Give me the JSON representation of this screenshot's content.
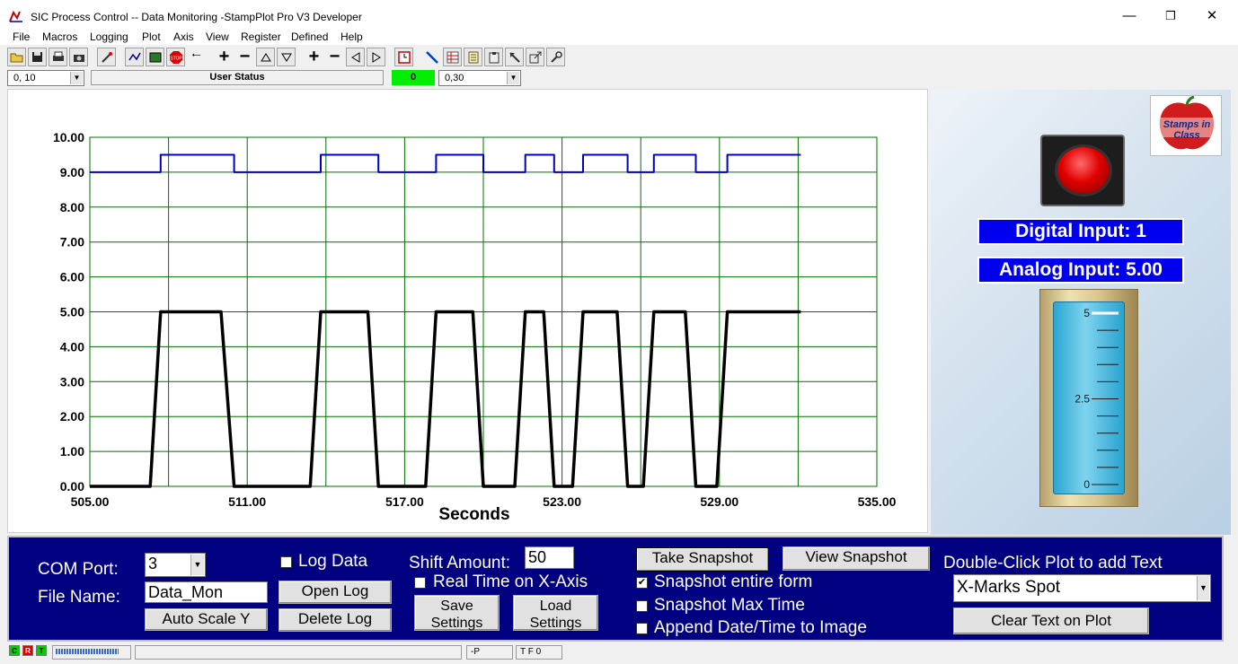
{
  "window": {
    "title": "SIC Process Control -- Data Monitoring  -StampPlot Pro V3 Developer",
    "minimize": "—",
    "maximize": "❐",
    "close": "✕"
  },
  "menu": [
    "File",
    "Macros",
    "Logging",
    "Plot",
    "Axis",
    "View",
    "Register",
    "Defined",
    "Help"
  ],
  "statusrow": {
    "left_combo": "0, 10",
    "user_status": "User Status",
    "green_value": "0",
    "right_combo": "0,30"
  },
  "chart_data": {
    "type": "line",
    "xlabel": "Seconds",
    "xlim": [
      505,
      535
    ],
    "ylim": [
      0,
      10
    ],
    "xticks": [
      "505.00",
      "511.00",
      "517.00",
      "523.00",
      "529.00",
      "535.00"
    ],
    "yticks": [
      "0.00",
      "1.00",
      "2.00",
      "3.00",
      "4.00",
      "5.00",
      "6.00",
      "7.00",
      "8.00",
      "9.00",
      "10.00"
    ],
    "grid": true,
    "series": [
      {
        "color": "#0000c0",
        "points": [
          [
            505,
            9
          ],
          [
            507.7,
            9
          ],
          [
            507.7,
            9.5
          ],
          [
            510.5,
            9.5
          ],
          [
            510.5,
            9
          ],
          [
            513.8,
            9
          ],
          [
            513.8,
            9.5
          ],
          [
            516.0,
            9.5
          ],
          [
            516.0,
            9
          ],
          [
            518.2,
            9
          ],
          [
            518.2,
            9.5
          ],
          [
            520.0,
            9.5
          ],
          [
            520.0,
            9
          ],
          [
            521.6,
            9
          ],
          [
            521.6,
            9.5
          ],
          [
            522.7,
            9.5
          ],
          [
            522.7,
            9
          ],
          [
            523.8,
            9
          ],
          [
            523.8,
            9.5
          ],
          [
            525.5,
            9.5
          ],
          [
            525.5,
            9
          ],
          [
            526.5,
            9
          ],
          [
            526.5,
            9.5
          ],
          [
            528.1,
            9.5
          ],
          [
            528.1,
            9
          ],
          [
            529.3,
            9
          ],
          [
            529.3,
            9.5
          ],
          [
            532.1,
            9.5
          ]
        ]
      },
      {
        "color": "#000000",
        "points": [
          [
            505,
            0
          ],
          [
            507.3,
            0
          ],
          [
            507.7,
            5
          ],
          [
            509.1,
            5
          ],
          [
            510.0,
            5
          ],
          [
            510.5,
            0
          ],
          [
            512.0,
            0
          ],
          [
            513.4,
            0
          ],
          [
            513.8,
            5
          ],
          [
            515.6,
            5
          ],
          [
            516.0,
            0
          ],
          [
            517.8,
            0
          ],
          [
            518.2,
            5
          ],
          [
            519.6,
            5
          ],
          [
            520.0,
            0
          ],
          [
            521.2,
            0
          ],
          [
            521.6,
            5
          ],
          [
            522.3,
            5
          ],
          [
            522.7,
            0
          ],
          [
            523.4,
            0
          ],
          [
            523.8,
            5
          ],
          [
            525.1,
            5
          ],
          [
            525.5,
            0
          ],
          [
            526.1,
            0
          ],
          [
            526.5,
            5
          ],
          [
            527.7,
            5
          ],
          [
            528.1,
            0
          ],
          [
            528.9,
            0
          ],
          [
            529.3,
            5
          ],
          [
            532.1,
            5
          ]
        ]
      }
    ]
  },
  "right_panel": {
    "logo_text": "Stamps in Class",
    "digital_input": "Digital Input: 1",
    "analog_input": "Analog Input: 5.00",
    "tank_level": 5,
    "tank_max": 5,
    "tank_labels": [
      "5",
      "2.5",
      "0"
    ]
  },
  "controls": {
    "com_port_label": "COM Port:",
    "com_port_value": "3",
    "file_name_label": "File Name:",
    "file_name_value": "Data_Mon",
    "auto_scale": "Auto Scale Y",
    "log_data_label": "Log Data",
    "open_log": "Open Log",
    "delete_log": "Delete Log",
    "shift_amount_label": "Shift Amount:",
    "shift_amount_value": "50",
    "real_time_label": "Real Time on X-Axis",
    "save_settings_1": "Save",
    "save_settings_2": "Settings",
    "load_settings_1": "Load",
    "load_settings_2": "Settings",
    "take_snapshot": "Take Snapshot",
    "view_snapshot": "View Snapshot",
    "snap_entire": "Snapshot entire form",
    "snap_max": "Snapshot Max Time",
    "append_date": "Append Date/Time to Image",
    "dbl_click_label": "Double-Click Plot to add Text",
    "text_combo": "X-Marks Spot",
    "clear_text": "Clear Text on Plot",
    "checks": {
      "log_data": false,
      "real_time": false,
      "snap_entire": true,
      "snap_max": false,
      "append_date": false
    }
  },
  "statusbar": {
    "c": "C",
    "r": "R",
    "t": "T",
    "field_p": "-P",
    "field_tf": "T F 0"
  }
}
